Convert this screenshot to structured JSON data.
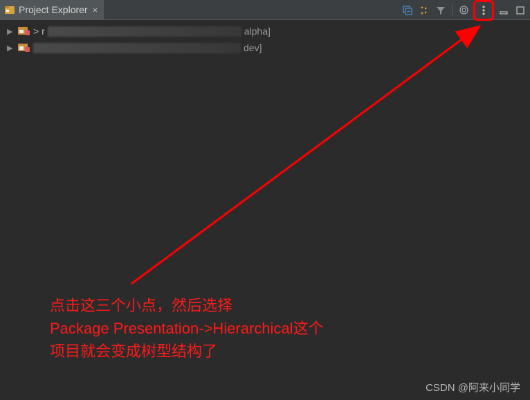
{
  "tab": {
    "title": "Project Explorer"
  },
  "tree": {
    "items": [
      {
        "suffix": "alpha]",
        "blur_width": 280
      },
      {
        "suffix": "dev]",
        "blur_width": 300
      }
    ]
  },
  "annotation": {
    "line1": "点击这三个小点，然后选择",
    "line2": "Package Presentation->Hierarchical这个",
    "line3": "项目就会变成树型结构了"
  },
  "watermark": "CSDN @阿来小同学"
}
